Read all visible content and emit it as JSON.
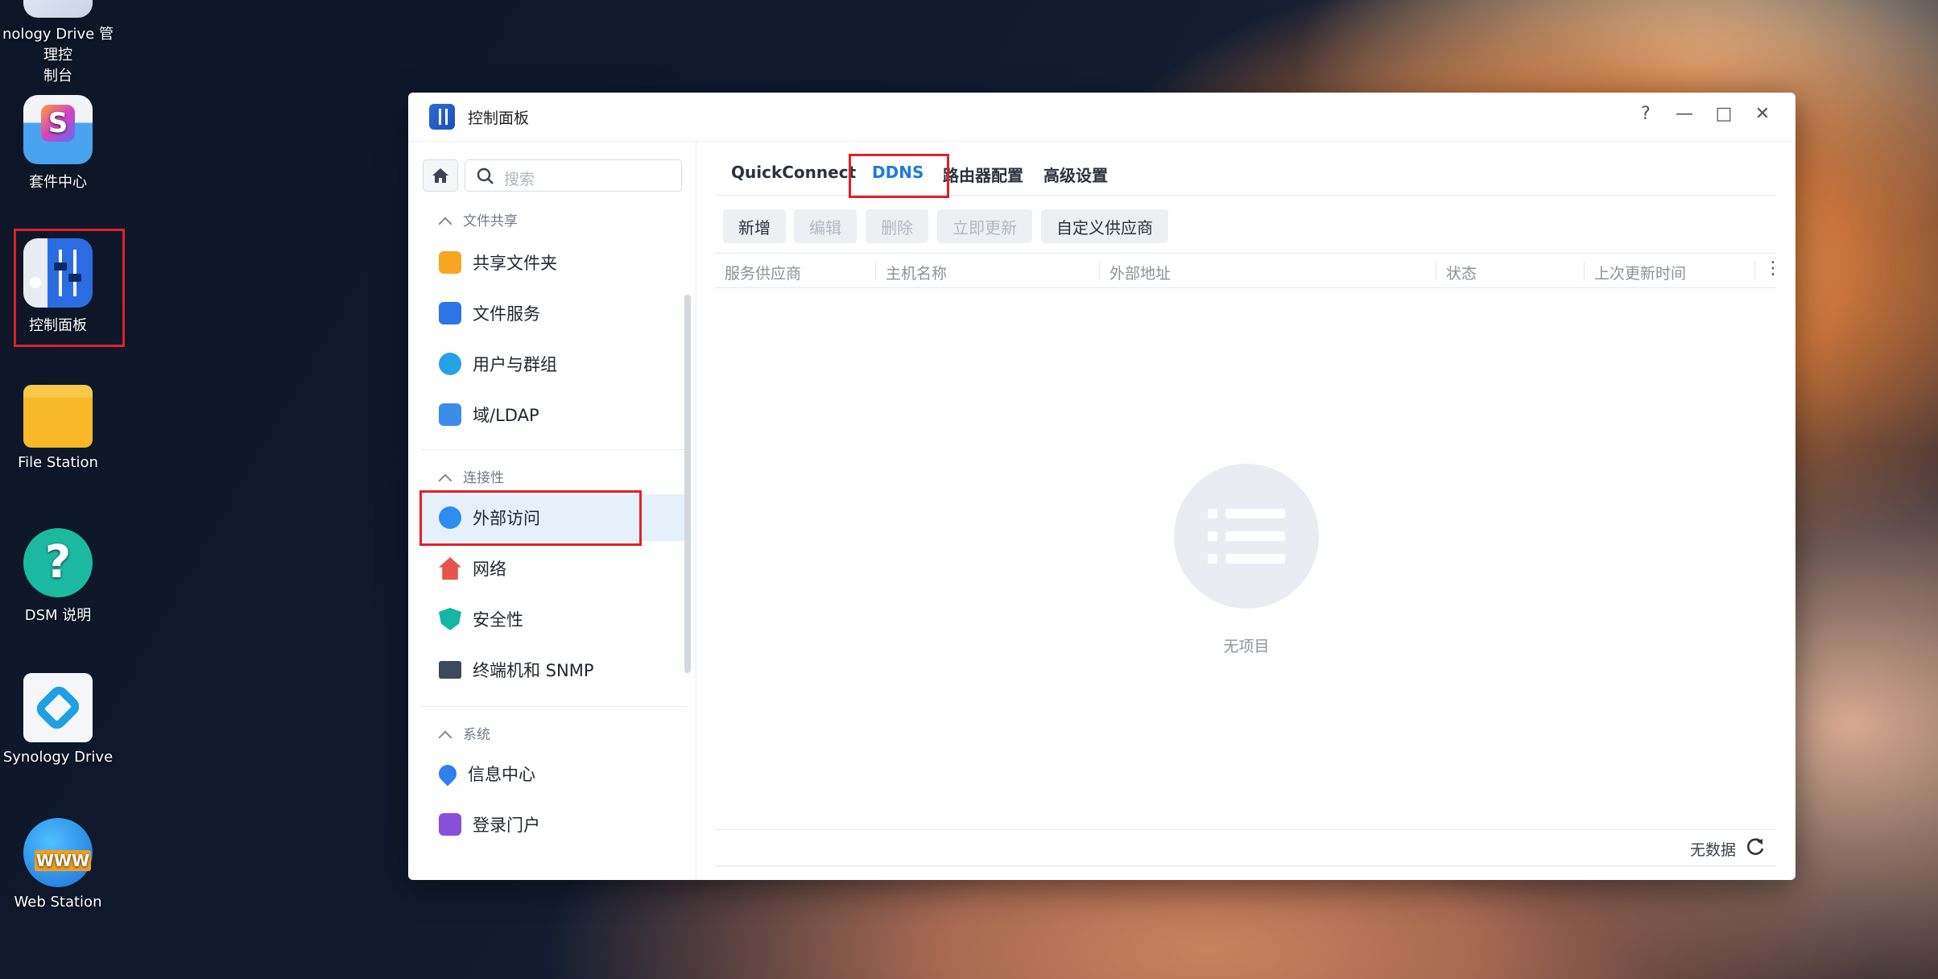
{
  "desktop": {
    "items": [
      {
        "label": "nology Drive 管理控\n制台"
      },
      {
        "label": "套件中心"
      },
      {
        "label": "控制面板"
      },
      {
        "label": "File Station"
      },
      {
        "label": "DSM 说明"
      },
      {
        "label": "Synology Drive"
      },
      {
        "label": "Web Station"
      }
    ]
  },
  "window": {
    "title": "控制面板",
    "controls": {
      "help": "?",
      "minimize": "—",
      "maximize": "□",
      "close": "✕"
    }
  },
  "sidebar": {
    "search_placeholder": "搜索",
    "sections": [
      {
        "title": "文件共享",
        "items": [
          "共享文件夹",
          "文件服务",
          "用户与群组",
          "域/LDAP"
        ]
      },
      {
        "title": "连接性",
        "items": [
          "外部访问",
          "网络",
          "安全性",
          "终端机和 SNMP"
        ]
      },
      {
        "title": "系统",
        "items": [
          "信息中心",
          "登录门户"
        ]
      }
    ],
    "active_item": "外部访问"
  },
  "tabs": [
    "QuickConnect",
    "DDNS",
    "路由器配置",
    "高级设置"
  ],
  "active_tab": "DDNS",
  "toolbar": {
    "add": "新增",
    "edit": "编辑",
    "delete": "删除",
    "update_now": "立即更新",
    "custom_provider": "自定义供应商"
  },
  "table": {
    "columns": [
      "服务供应商",
      "主机名称",
      "外部地址",
      "状态",
      "上次更新时间"
    ],
    "rows": [],
    "empty_text": "无项目"
  },
  "footer": {
    "status": "无数据"
  },
  "colors": {
    "accent": "#1f7ae0",
    "highlight_box": "#e0202a"
  }
}
